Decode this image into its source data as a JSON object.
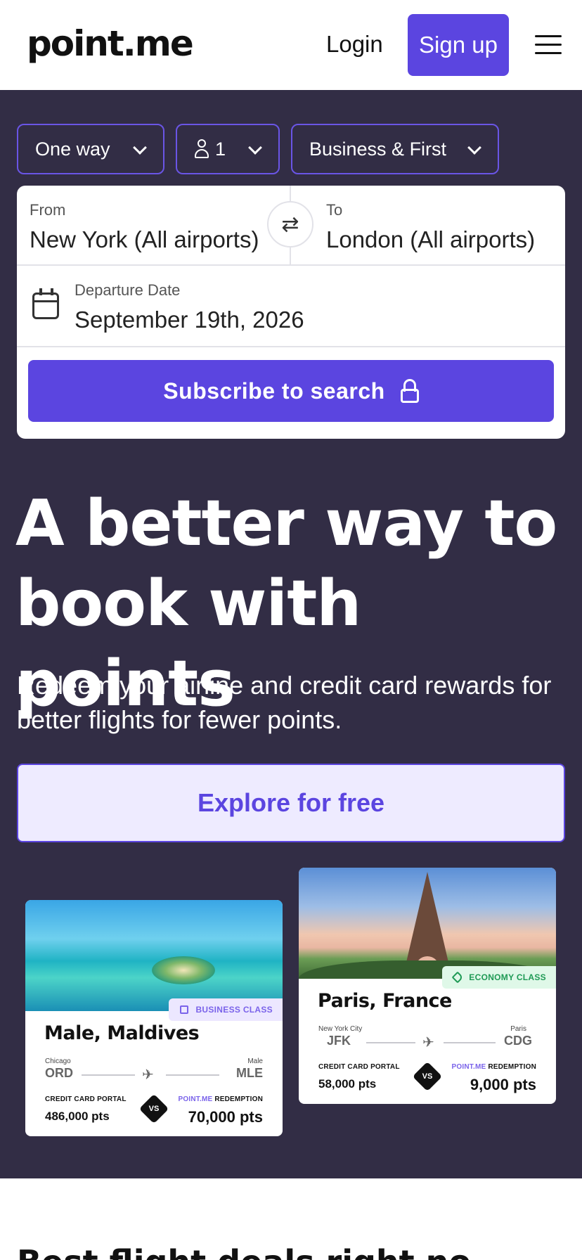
{
  "header": {
    "logo": "point.me",
    "login_label": "Login",
    "signup_label": "Sign up"
  },
  "search": {
    "trip_type": "One way",
    "passengers": "1",
    "cabin": "Business & First",
    "from_label": "From",
    "from_value": "New York (All airports)",
    "to_label": "To",
    "to_value": "London (All airports)",
    "date_label": "Departure Date",
    "date_value": "September 19th, 2026",
    "submit_label": "Subscribe to search"
  },
  "hero": {
    "headline": "A better way to book with points",
    "subheadline": "Redeem your airline and credit card rewards for better flights for fewer points.",
    "cta_label": "Explore for free"
  },
  "deals": [
    {
      "title": "Male, Maldives",
      "badge": "BUSINESS CLASS",
      "origin_city": "Chicago",
      "origin_code": "ORD",
      "dest_city": "Male",
      "dest_code": "MLE",
      "portal_label": "CREDIT CARD PORTAL",
      "portal_pts": "486,000 pts",
      "vs": "VS",
      "redemption_accent": "POINT.ME",
      "redemption_label": "REDEMPTION",
      "redemption_pts": "70,000 pts"
    },
    {
      "title": "Paris, France",
      "badge": "ECONOMY CLASS",
      "origin_city": "New York City",
      "origin_code": "JFK",
      "dest_city": "Paris",
      "dest_code": "CDG",
      "portal_label": "CREDIT CARD PORTAL",
      "portal_pts": "58,000 pts",
      "vs": "VS",
      "redemption_accent": "POINT.ME",
      "redemption_label": "REDEMPTION",
      "redemption_pts": "9,000 pts"
    }
  ],
  "section": {
    "title": "Best flight deals right no"
  },
  "colors": {
    "brand": "#5b45e0",
    "hero_bg": "#322d45",
    "cta_bg": "#eeebff"
  }
}
